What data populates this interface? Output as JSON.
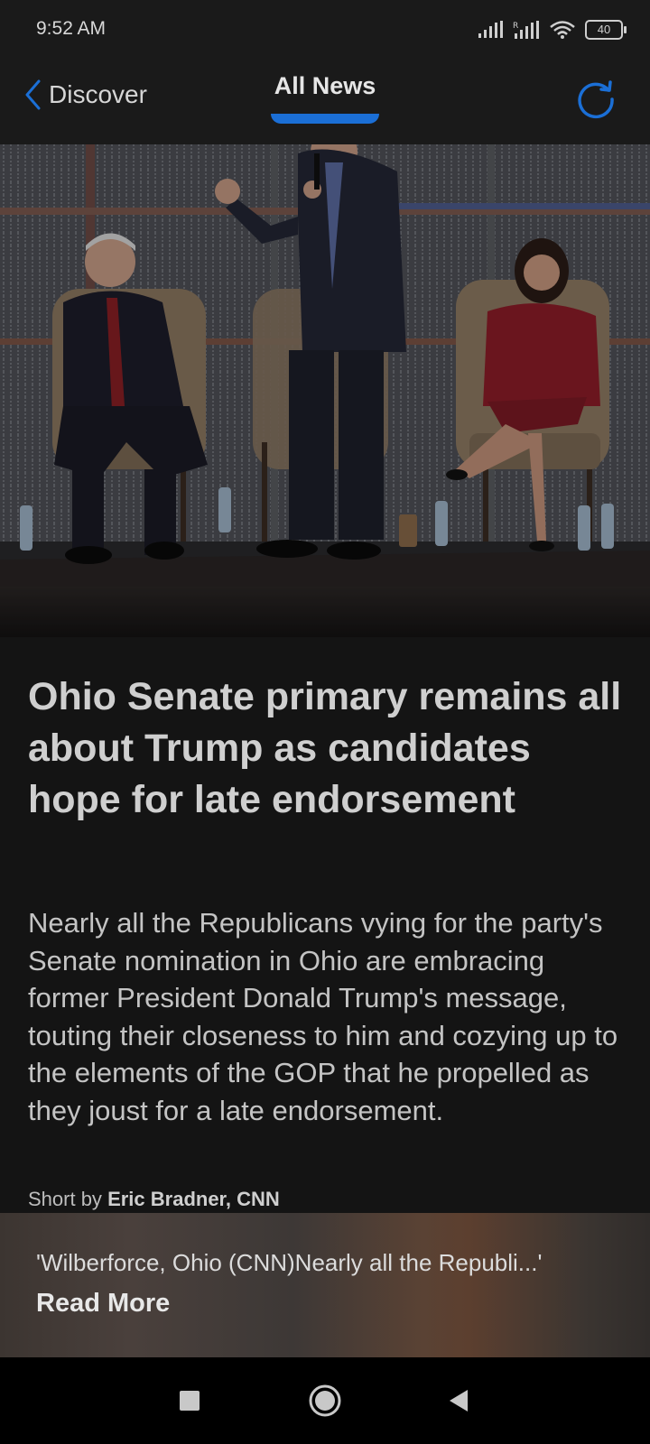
{
  "status_bar": {
    "time": "9:52 AM",
    "battery": "40"
  },
  "header": {
    "back_label": "Discover",
    "title": "All News"
  },
  "article": {
    "headline": "Ohio Senate primary remains all about Trump as candidates hope for late endorsement",
    "summary": "Nearly all the Republicans vying for the party's Senate nomination in Ohio are embracing former President Donald Trump's message, touting their closeness to him and cozying up to the elements of the GOP that he propelled as they joust for a late endorsement.",
    "byline_prefix": "Short by",
    "byline_author": "Eric Bradner, CNN"
  },
  "read_more_card": {
    "excerpt": "'Wilberforce, Ohio (CNN)Nearly all the Republi...'",
    "cta": "Read More"
  },
  "icons": {
    "back": "chevron-left-icon",
    "refresh": "refresh-icon",
    "nav_recents": "square-icon",
    "nav_home": "circle-icon",
    "nav_back": "triangle-back-icon"
  },
  "colors": {
    "accent": "#1b6fd6",
    "background": "#141414"
  }
}
